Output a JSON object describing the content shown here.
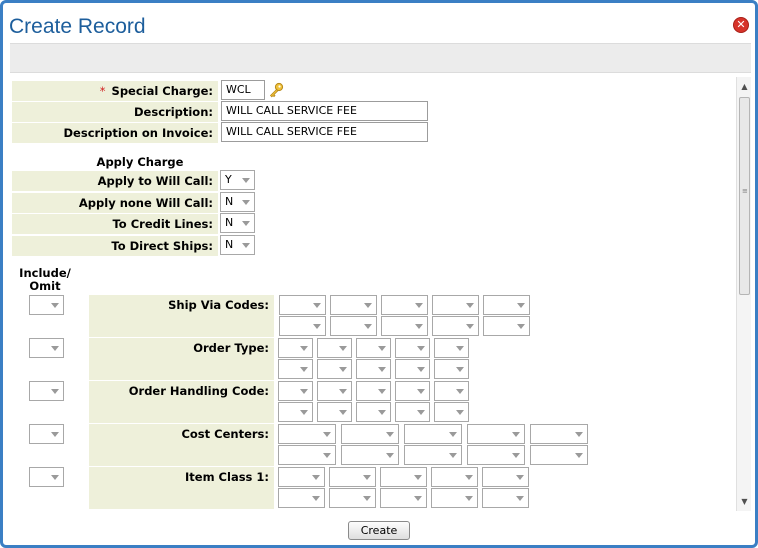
{
  "dialog": {
    "title": "Create Record"
  },
  "form": {
    "special_charge": {
      "required_mark": "*",
      "label": "Special Charge:",
      "value": "WCL"
    },
    "description": {
      "label": "Description:",
      "value": "WILL CALL SERVICE FEE"
    },
    "description_invoice": {
      "label": "Description on Invoice:",
      "value": "WILL CALL SERVICE FEE"
    },
    "apply_heading": "Apply Charge",
    "apply": [
      {
        "label": "Apply to Will Call:",
        "value": "Y"
      },
      {
        "label": "Apply none Will Call:",
        "value": "N"
      },
      {
        "label": "To Credit Lines:",
        "value": "N"
      },
      {
        "label": "To Direct Ships:",
        "value": "N"
      }
    ],
    "include_heading": "Include/ Omit",
    "code_groups": [
      {
        "label": "Ship Via Codes:",
        "cols": 5
      },
      {
        "label": "Order Type:",
        "cols": 5
      },
      {
        "label": "Order Handling Code:",
        "cols": 5
      },
      {
        "label": "Cost Centers:",
        "cols": 5
      },
      {
        "label": "Item Class 1:",
        "cols": 5
      }
    ]
  },
  "actions": {
    "create_label": "Create"
  }
}
